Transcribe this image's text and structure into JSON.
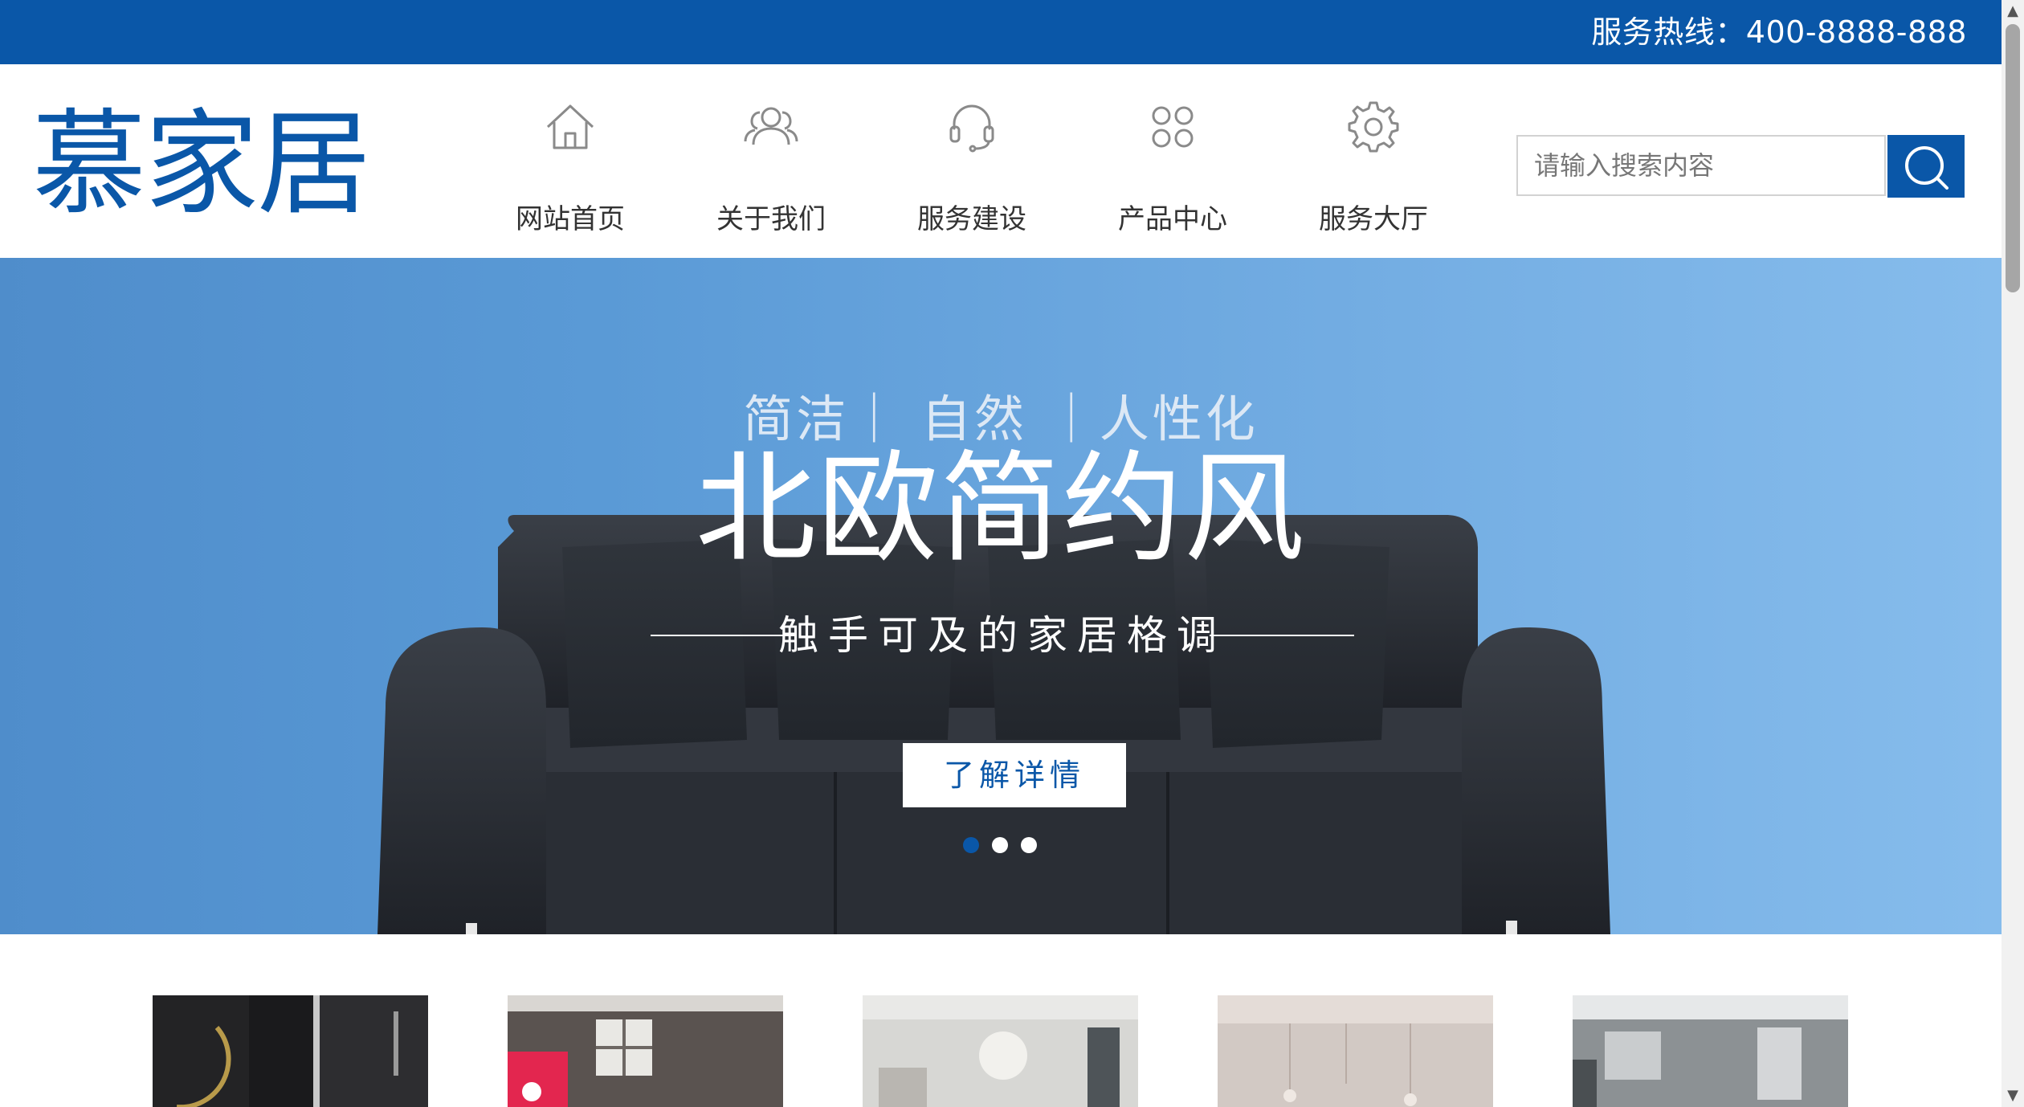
{
  "topbar": {
    "hotline": "服务热线：400-8888-888"
  },
  "header": {
    "logo": "慕家居",
    "nav": [
      {
        "label": "网站首页",
        "icon": "home-icon"
      },
      {
        "label": "关于我们",
        "icon": "users-icon"
      },
      {
        "label": "服务建设",
        "icon": "headset-icon"
      },
      {
        "label": "产品中心",
        "icon": "grid-icon"
      },
      {
        "label": "服务大厅",
        "icon": "gear-icon"
      }
    ],
    "search": {
      "placeholder": "请输入搜索内容",
      "button_icon": "search-icon"
    }
  },
  "banner": {
    "subtitle": "简洁｜ 自然 ｜人性化",
    "title": "北欧简约风",
    "tagline": "触手可及的家居格调",
    "button": "了解详情",
    "slides_total": 3,
    "active_slide": 1
  },
  "thumbnails": [
    {
      "name": "bathroom"
    },
    {
      "name": "bedroom-pink"
    },
    {
      "name": "bedroom-light"
    },
    {
      "name": "dining-room"
    },
    {
      "name": "living-room-gray"
    }
  ],
  "colors": {
    "brand": "#0a57a8",
    "banner_light": "#86bcec",
    "banner_dark": "#4f8dcb",
    "sofa": "#2b2f36"
  }
}
